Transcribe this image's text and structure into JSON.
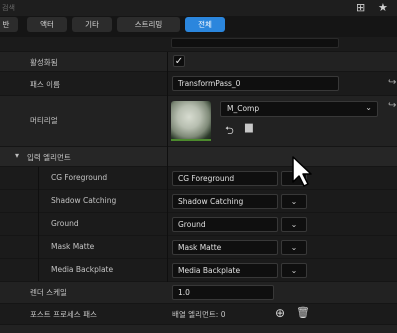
{
  "topbar": {
    "search_text": "검색",
    "grid_icon": "grid-icon",
    "star_icon": "star-icon"
  },
  "tabs": [
    {
      "label": "반",
      "active": false
    },
    {
      "label": "액터",
      "active": false
    },
    {
      "label": "기타",
      "active": false
    },
    {
      "label": "스트리밍",
      "active": false
    },
    {
      "label": "전체",
      "active": true
    }
  ],
  "props": {
    "active": {
      "label": "활성화됨",
      "checked": "✓"
    },
    "pass_name": {
      "label": "패스 이름",
      "value": "TransformPass_0"
    },
    "material": {
      "label": "머티리얼",
      "value": "M_Comp"
    },
    "input_elements": {
      "header": "입력 엘리먼트",
      "items": [
        {
          "label": "CG Foreground",
          "value": "CG Foreground"
        },
        {
          "label": "Shadow Catching",
          "value": "Shadow Catching"
        },
        {
          "label": "Ground",
          "value": "Ground"
        },
        {
          "label": "Mask Matte",
          "value": "Mask Matte"
        },
        {
          "label": "Media Backplate",
          "value": "Media Backplate"
        }
      ]
    },
    "render_scale": {
      "label": "렌더 스케일",
      "value": "1.0"
    },
    "post_process": {
      "label": "포스트 프로세스 패스",
      "value": "배열 엘리먼트: 0"
    }
  },
  "colors": {
    "accent": "#2b86dd",
    "thumb_bar": "#4c8a2d"
  }
}
